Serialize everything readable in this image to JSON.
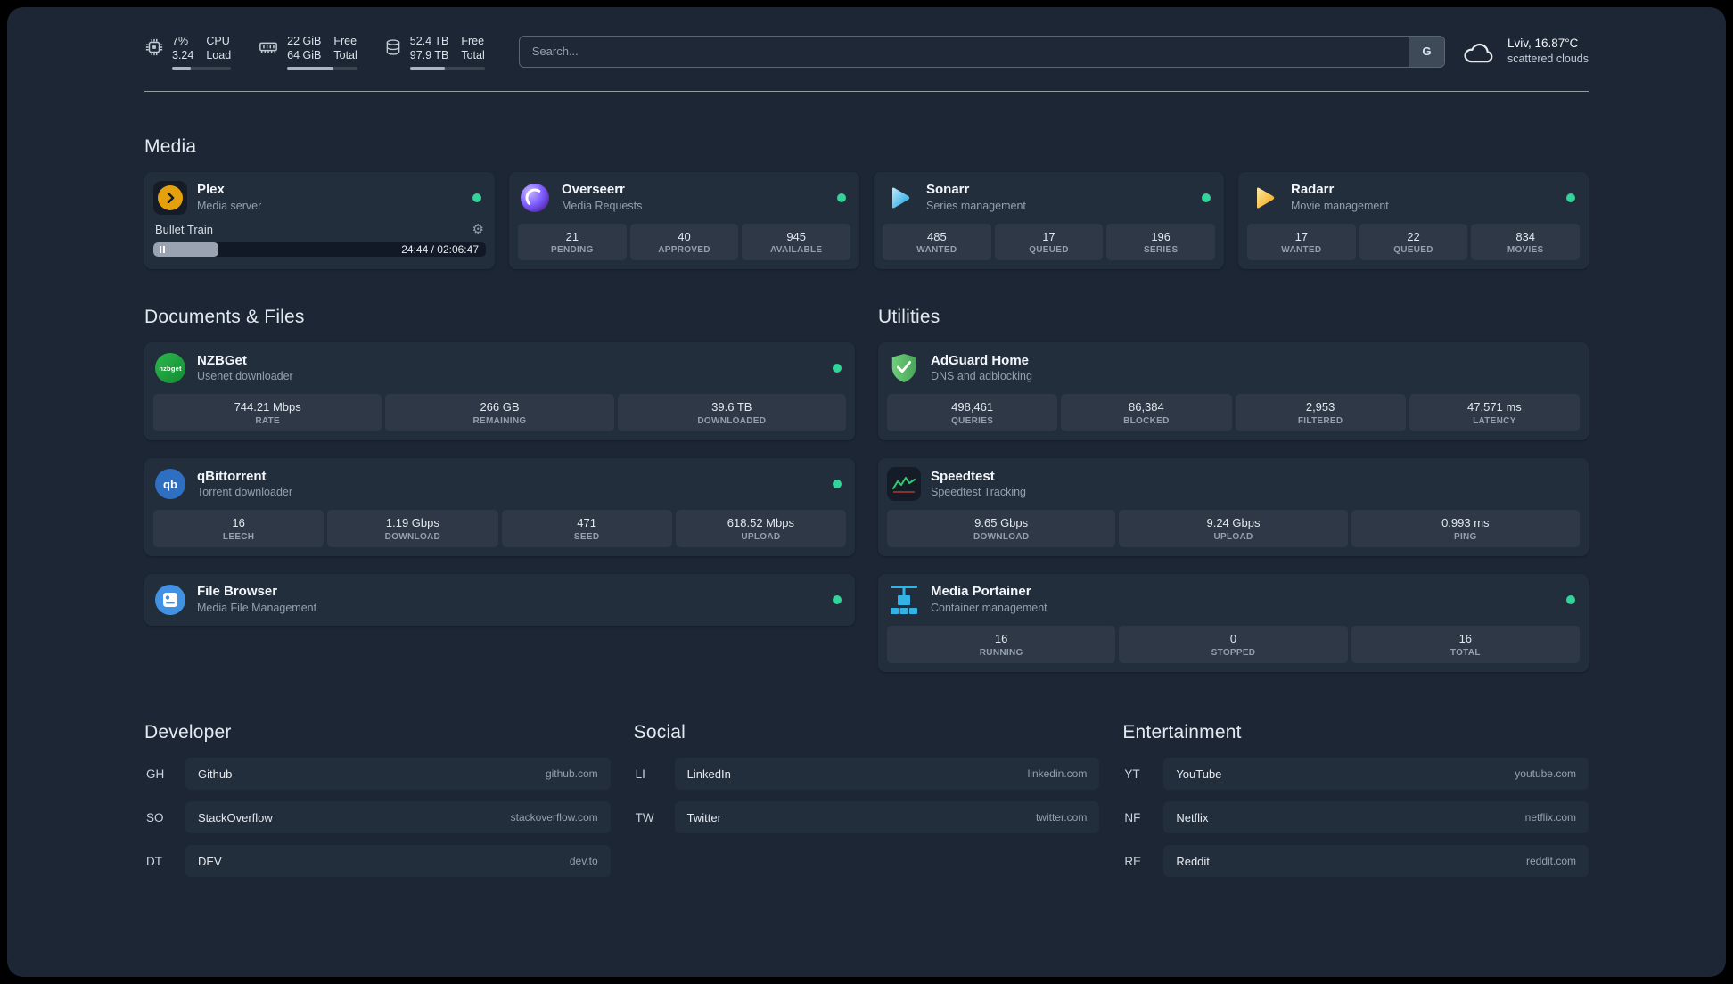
{
  "topbar": {
    "cpu": {
      "value": "7%",
      "load": "3.24",
      "label_top": "CPU",
      "label_bottom": "Load",
      "bar_percent": 32
    },
    "memory": {
      "free": "22 GiB",
      "total": "64 GiB",
      "label_top": "Free",
      "label_bottom": "Total",
      "bar_percent": 66
    },
    "disk": {
      "free": "52.4 TB",
      "total": "97.9 TB",
      "label_top": "Free",
      "label_bottom": "Total",
      "bar_percent": 47
    },
    "search": {
      "placeholder": "Search...",
      "provider_label": "G"
    },
    "weather": {
      "location": "Lviv, 16.87°C",
      "condition": "scattered clouds"
    }
  },
  "media": {
    "heading": "Media",
    "plex": {
      "title": "Plex",
      "subtitle": "Media server",
      "now_playing": {
        "title": "Bullet Train",
        "time": "24:44 / 02:06:47",
        "progress_percent": 19.5
      }
    },
    "overseerr": {
      "title": "Overseerr",
      "subtitle": "Media Requests",
      "stats": [
        {
          "value": "21",
          "label": "PENDING"
        },
        {
          "value": "40",
          "label": "APPROVED"
        },
        {
          "value": "945",
          "label": "AVAILABLE"
        }
      ]
    },
    "sonarr": {
      "title": "Sonarr",
      "subtitle": "Series management",
      "stats": [
        {
          "value": "485",
          "label": "WANTED"
        },
        {
          "value": "17",
          "label": "QUEUED"
        },
        {
          "value": "196",
          "label": "SERIES"
        }
      ]
    },
    "radarr": {
      "title": "Radarr",
      "subtitle": "Movie management",
      "stats": [
        {
          "value": "17",
          "label": "WANTED"
        },
        {
          "value": "22",
          "label": "QUEUED"
        },
        {
          "value": "834",
          "label": "MOVIES"
        }
      ]
    }
  },
  "documents": {
    "heading": "Documents & Files",
    "nzbget": {
      "title": "NZBGet",
      "subtitle": "Usenet downloader",
      "icon_text": "nzbget",
      "stats": [
        {
          "value": "744.21 Mbps",
          "label": "RATE"
        },
        {
          "value": "266 GB",
          "label": "REMAINING"
        },
        {
          "value": "39.6 TB",
          "label": "DOWNLOADED"
        }
      ]
    },
    "qbittorrent": {
      "title": "qBittorrent",
      "subtitle": "Torrent downloader",
      "icon_text": "qb",
      "stats": [
        {
          "value": "16",
          "label": "LEECH"
        },
        {
          "value": "1.19 Gbps",
          "label": "DOWNLOAD"
        },
        {
          "value": "471",
          "label": "SEED"
        },
        {
          "value": "618.52 Mbps",
          "label": "UPLOAD"
        }
      ]
    },
    "filebrowser": {
      "title": "File Browser",
      "subtitle": "Media File Management"
    }
  },
  "utilities": {
    "heading": "Utilities",
    "adguard": {
      "title": "AdGuard Home",
      "subtitle": "DNS and adblocking",
      "stats": [
        {
          "value": "498,461",
          "label": "QUERIES"
        },
        {
          "value": "86,384",
          "label": "BLOCKED"
        },
        {
          "value": "2,953",
          "label": "FILTERED"
        },
        {
          "value": "47.571 ms",
          "label": "LATENCY"
        }
      ]
    },
    "speedtest": {
      "title": "Speedtest",
      "subtitle": "Speedtest Tracking",
      "stats": [
        {
          "value": "9.65 Gbps",
          "label": "DOWNLOAD"
        },
        {
          "value": "9.24 Gbps",
          "label": "UPLOAD"
        },
        {
          "value": "0.993 ms",
          "label": "PING"
        }
      ]
    },
    "portainer": {
      "title": "Media Portainer",
      "subtitle": "Container management",
      "stats": [
        {
          "value": "16",
          "label": "RUNNING"
        },
        {
          "value": "0",
          "label": "STOPPED"
        },
        {
          "value": "16",
          "label": "TOTAL"
        }
      ]
    }
  },
  "bookmarks": {
    "developer": {
      "heading": "Developer",
      "items": [
        {
          "abbr": "GH",
          "name": "Github",
          "url": "github.com"
        },
        {
          "abbr": "SO",
          "name": "StackOverflow",
          "url": "stackoverflow.com"
        },
        {
          "abbr": "DT",
          "name": "DEV",
          "url": "dev.to"
        }
      ]
    },
    "social": {
      "heading": "Social",
      "items": [
        {
          "abbr": "LI",
          "name": "LinkedIn",
          "url": "linkedin.com"
        },
        {
          "abbr": "TW",
          "name": "Twitter",
          "url": "twitter.com"
        }
      ]
    },
    "entertainment": {
      "heading": "Entertainment",
      "items": [
        {
          "abbr": "YT",
          "name": "YouTube",
          "url": "youtube.com"
        },
        {
          "abbr": "NF",
          "name": "Netflix",
          "url": "netflix.com"
        },
        {
          "abbr": "RE",
          "name": "Reddit",
          "url": "reddit.com"
        }
      ]
    }
  },
  "colors": {
    "status_online": "#34d399",
    "plex_accent": "#e5a00d",
    "sonarr_accent": "#169fdb",
    "radarr_accent": "#f0a40a",
    "overseerr_accent": "#7c5cff",
    "nzbget_accent": "#2db84d",
    "qbittorrent_accent": "#2f6fc1",
    "filebrowser_accent": "#4192e3",
    "adguard_accent": "#67b279",
    "speedtest_accent": "#2ecc71",
    "portainer_accent": "#33b2e5"
  }
}
